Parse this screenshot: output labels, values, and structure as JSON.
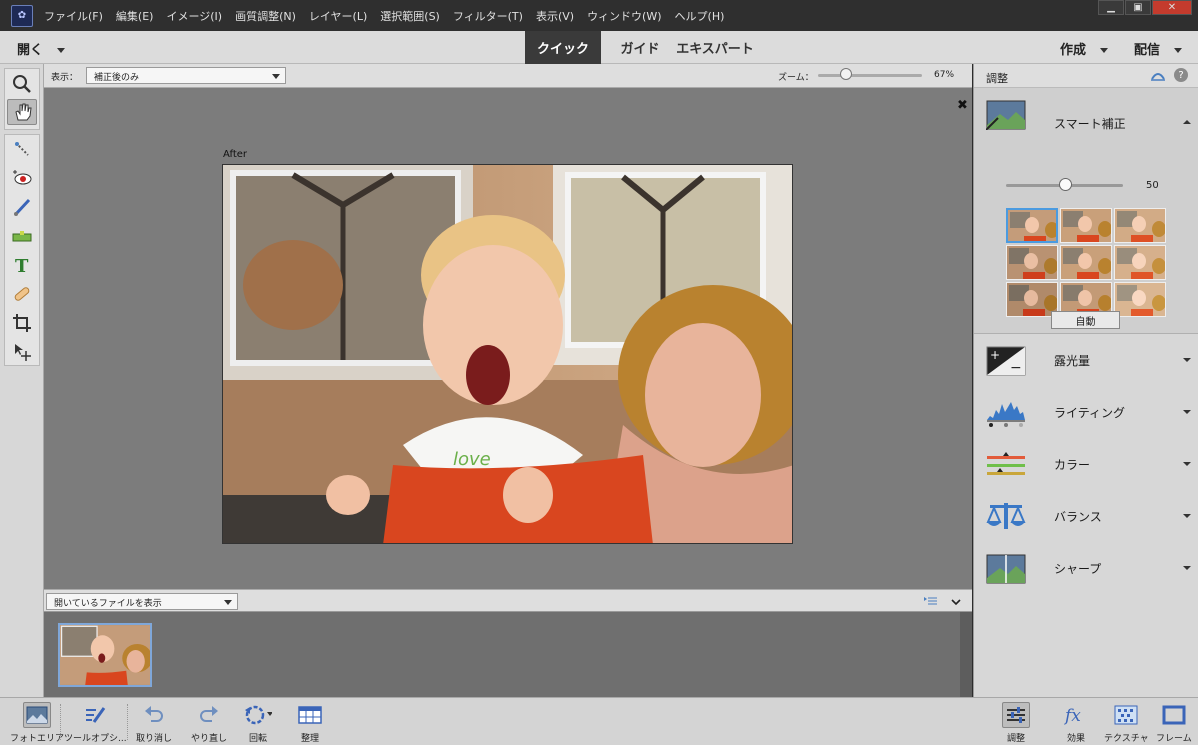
{
  "menubar": {
    "items": [
      "ファイル(F)",
      "編集(E)",
      "イメージ(I)",
      "画質調整(N)",
      "レイヤー(L)",
      "選択範囲(S)",
      "フィルター(T)",
      "表示(V)",
      "ウィンドウ(W)",
      "ヘルプ(H)"
    ]
  },
  "modebar": {
    "open_label": "開く",
    "tabs": [
      "クイック",
      "ガイド",
      "エキスパート"
    ],
    "active_tab": "クイック",
    "create_label": "作成",
    "share_label": "配信"
  },
  "viewbar": {
    "view_label": "表示：",
    "view_value": "補正後のみ",
    "zoom_label": "ズーム：",
    "zoom_value": "67%",
    "zoom_level_percent": 67
  },
  "canvas": {
    "after_label": "After",
    "close_glyph": "✖"
  },
  "photo_bin": {
    "show_value": "開いているファイルを表示"
  },
  "adjustments": {
    "title": "調整",
    "smart_fix": {
      "label": "スマート補正",
      "value": "50"
    },
    "auto_button": "自動",
    "items": [
      "露光量",
      "ライティング",
      "カラー",
      "バランス",
      "シャープ"
    ]
  },
  "taskbar": {
    "left": [
      "フォトエリア",
      "ツールオプシ...",
      "取り消し",
      "やり直し",
      "回転",
      "整理"
    ],
    "right": [
      "調整",
      "効果",
      "テクスチャ",
      "フレーム"
    ]
  },
  "colors": {
    "accent": "#4b9be0",
    "menubar_bg": "#2f2f2f",
    "canvas_bg": "#7c7c7c"
  }
}
